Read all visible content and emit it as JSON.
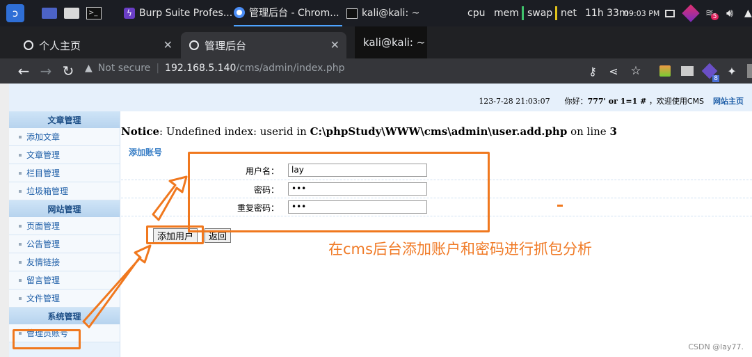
{
  "taskbar": {
    "apps": [
      {
        "label": "Burp Suite Profes..."
      },
      {
        "label": "管理后台 - Chrom..."
      },
      {
        "label": "kali@kali: ~"
      }
    ],
    "monitors": [
      "cpu",
      "mem",
      "swap",
      "net"
    ],
    "uptime": "11h 33m",
    "clock": "09:03 PM",
    "badge_count": "5"
  },
  "browser": {
    "tabs": [
      {
        "label": "个人主页"
      },
      {
        "label": "管理后台"
      },
      {
        "label": "kali@kali: ~"
      }
    ],
    "security_label": "Not secure",
    "url_host": "192.168.5.140",
    "url_path": "/cms/admin/index.php",
    "ext_badge": "8"
  },
  "page": {
    "top_info": {
      "datetime": "123-7-28 21:03:07",
      "greeting_prefix": "你好：",
      "username": "777' or 1=1 #",
      "welcome": "，欢迎使用CMS",
      "home_link": "网站主页"
    },
    "sidebar": {
      "sections": [
        {
          "title": "文章管理",
          "items": [
            "添加文章",
            "文章管理",
            "栏目管理",
            "垃圾箱管理"
          ]
        },
        {
          "title": "网站管理",
          "items": [
            "页面管理",
            "公告管理",
            "友情链接",
            "留言管理",
            "文件管理"
          ]
        },
        {
          "title": "系统管理",
          "items": [
            "管理员账号"
          ]
        }
      ]
    },
    "notice": {
      "label": "Notice",
      "message": ": Undefined index: userid in ",
      "path": "C:\\phpStudy\\WWW\\cms\\admin\\user.add.php",
      "on_line": " on line ",
      "line": "3"
    },
    "form": {
      "title": "添加账号",
      "fields": [
        {
          "label": "用户名：",
          "value": "lay"
        },
        {
          "label": "密码：",
          "value": "•••"
        },
        {
          "label": "重复密码：",
          "value": "•••"
        }
      ],
      "submit_label": "添加用户",
      "back_label": "返回"
    },
    "annotation_text": "在cms后台添加账户和密码进行抓包分析",
    "watermark": "CSDN @lay77."
  },
  "colors": {
    "highlight": "#f0781e",
    "link": "#1f5fa8"
  }
}
